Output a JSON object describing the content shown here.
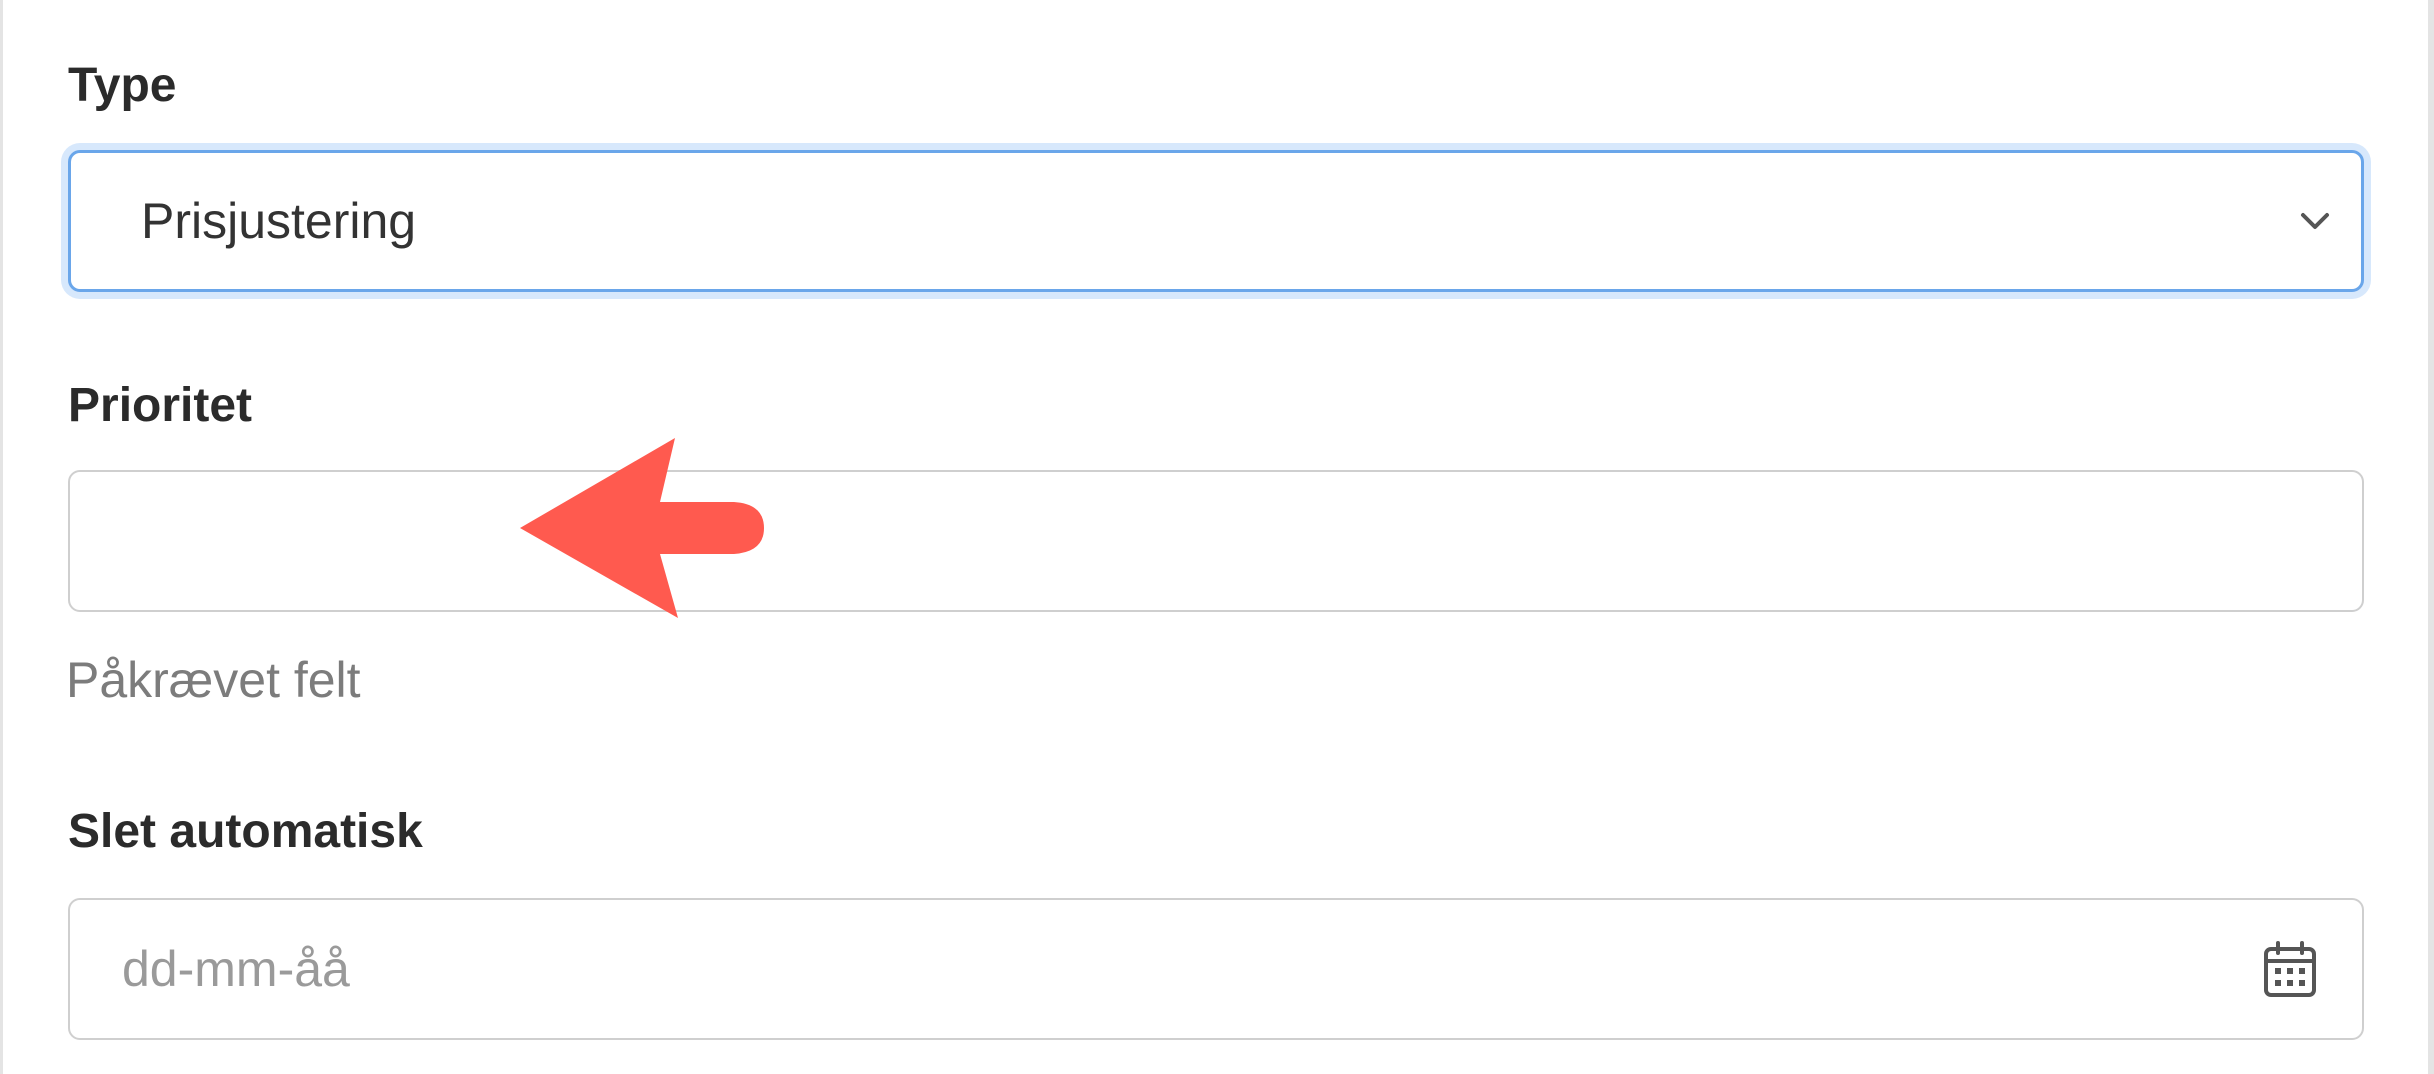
{
  "type_field": {
    "label": "Type",
    "selected_value": "Prisjustering",
    "chevron_icon": "chevron-down-icon"
  },
  "priority_field": {
    "label": "Prioritet",
    "value": "",
    "help_text": "Påkrævet felt"
  },
  "auto_delete_field": {
    "label": "Slet automatisk",
    "placeholder": "dd-mm-åå",
    "calendar_icon": "calendar-icon"
  },
  "annotation": {
    "arrow_icon": "arrow-left-icon",
    "color": "#ff5a4f"
  },
  "colors": {
    "focus_border": "#6aa6ea",
    "border": "#cfcfcf",
    "label_text": "#2b2b2b",
    "help_text": "#7c7c7c"
  }
}
